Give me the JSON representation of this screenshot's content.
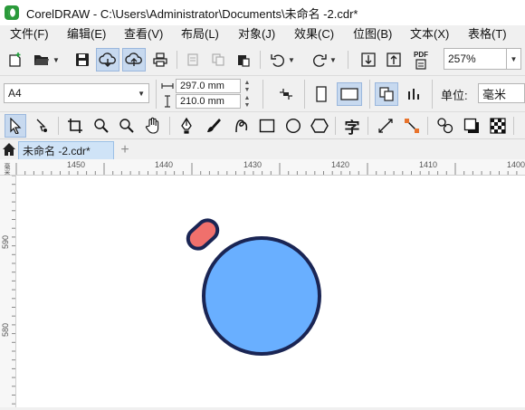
{
  "window": {
    "title": "CorelDRAW - C:\\Users\\Administrator\\Documents\\未命名 -2.cdr*"
  },
  "menu": [
    {
      "label": "文件(F)"
    },
    {
      "label": "编辑(E)"
    },
    {
      "label": "查看(V)"
    },
    {
      "label": "布局(L)"
    },
    {
      "label": "对象(J)"
    },
    {
      "label": "效果(C)"
    },
    {
      "label": "位图(B)"
    },
    {
      "label": "文本(X)"
    },
    {
      "label": "表格(T)"
    }
  ],
  "standard_toolbar": {
    "zoom": "257%",
    "pdf_label": "PDF"
  },
  "property_bar": {
    "page_size": "A4",
    "width": "297.0 mm",
    "height": "210.0 mm",
    "units_label": "单位:",
    "units_value": "毫米"
  },
  "toolbox": {
    "text_tool_glyph": "字"
  },
  "document_tabs": [
    {
      "label": "未命名 -2.cdr*",
      "active": true
    }
  ],
  "rulers": {
    "horizontal_labels": [
      "1450",
      "1440",
      "1430",
      "1420",
      "1410",
      "1400"
    ],
    "vertical_labels": [
      "590",
      "580"
    ],
    "corner_label": "毫米"
  },
  "canvas": {
    "shapes": [
      {
        "kind": "circle",
        "fill": "#69afff",
        "stroke": "#1a2554"
      },
      {
        "kind": "pill",
        "fill": "#f0706c",
        "stroke": "#1a2554"
      }
    ]
  },
  "colors": {
    "accent_pressed": "#c7d9ef",
    "tab_active": "#cfe3f7",
    "logo": "#2a9a3a"
  }
}
